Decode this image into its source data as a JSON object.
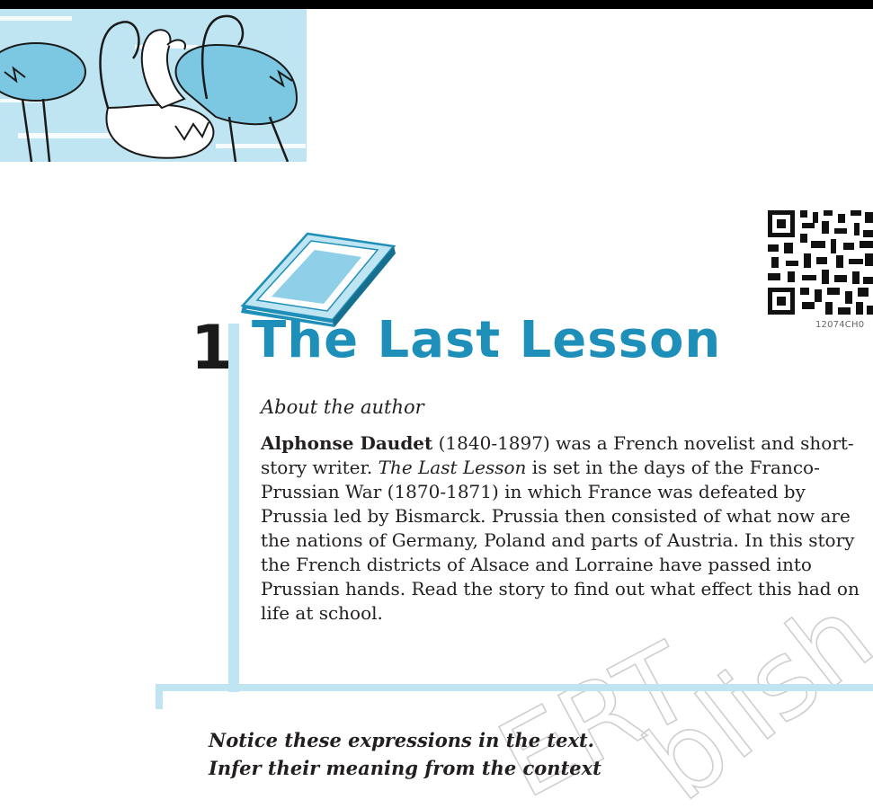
{
  "chapter": {
    "number": "1",
    "title": "The Last Lesson"
  },
  "qr_code": {
    "label": "12074CH0"
  },
  "about": {
    "heading": "About the author",
    "author_name": "Alphonse Daudet",
    "intro": " (1840-1897) was a French novelist and short-story writer. ",
    "story_title": "The Last Lesson",
    "body": " is set in the days of the Franco-Prussian War (1870-1871) in which France was defeated by Prussia led by Bismarck. Prussia then consisted of what now are the nations of Germany, Poland and parts of Austria. In this story the French districts of Alsace and Lorraine have passed into Prussian hands. Read the story to find out what effect this had on life at school."
  },
  "notice": {
    "line1": "Notice these expressions in the text.",
    "line2": "Infer their meaning from the context"
  },
  "watermark": {
    "left_text": "ERT",
    "right_text": "blish"
  },
  "colors": {
    "accent_blue": "#1e8fb8",
    "light_blue": "#bfe4f2"
  }
}
